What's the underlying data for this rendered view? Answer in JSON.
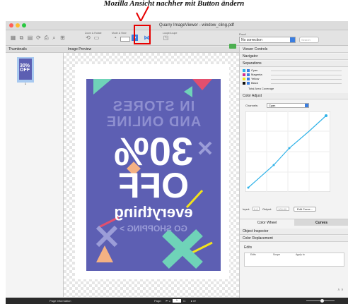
{
  "caption": "Mozilla Ansicht nachher mit Button ändern",
  "window": {
    "title": "Quarry ImageViewer - window_cling.pdf"
  },
  "toolbar": {
    "group_zoom": "Zoom & Rotate",
    "group_mode": "Mode & View",
    "group_loupe": "Loupe/Loupe",
    "proofing_label": "Proof",
    "proofing_value": "No correction",
    "search_placeholder": "Search"
  },
  "thumbnails": {
    "header": "Thumbnails",
    "page_number": "1",
    "thumb_line1": "30%",
    "thumb_line2": "OFF"
  },
  "preview": {
    "header": "Image Preview",
    "poster": {
      "line1": "IN STORES",
      "line2": "AND ONLINE",
      "line3": "30%",
      "line4": "OFF",
      "line5": "everything",
      "line6": "GO SHOPPING >"
    }
  },
  "right_panel": {
    "viewer_controls": "Viewer Controls",
    "navigator": "Navigator",
    "separations": "Separations",
    "separation_items": [
      {
        "label": "Cyan",
        "color": "#2fb2e8"
      },
      {
        "label": "Magenta",
        "color": "#d12f8d"
      },
      {
        "label": "Yellow",
        "color": "#f2e21c"
      },
      {
        "label": "Black",
        "color": "#111111"
      }
    ],
    "total_area": "Total Area Coverage",
    "color_adjust": "Color Adjust",
    "channels_label": "Channels:",
    "channels_value": "Cyan",
    "input_label": "Input:",
    "input_value": "0.0",
    "output_label": "Output:",
    "output_value": "100.00",
    "edit_curve": "Edit Curve...",
    "tab_color_wheel": "Color Wheel",
    "tab_curves": "Curves",
    "object_inspector": "Object Inspector",
    "color_replacement": "Color Replacement",
    "edits": "Edits",
    "edits_cols": [
      "Edits",
      "Scope",
      "Apply to"
    ]
  },
  "statusbar": {
    "page_info": "Page Information",
    "page_label": "Page:",
    "page_value": "1",
    "page_total": "/1"
  }
}
